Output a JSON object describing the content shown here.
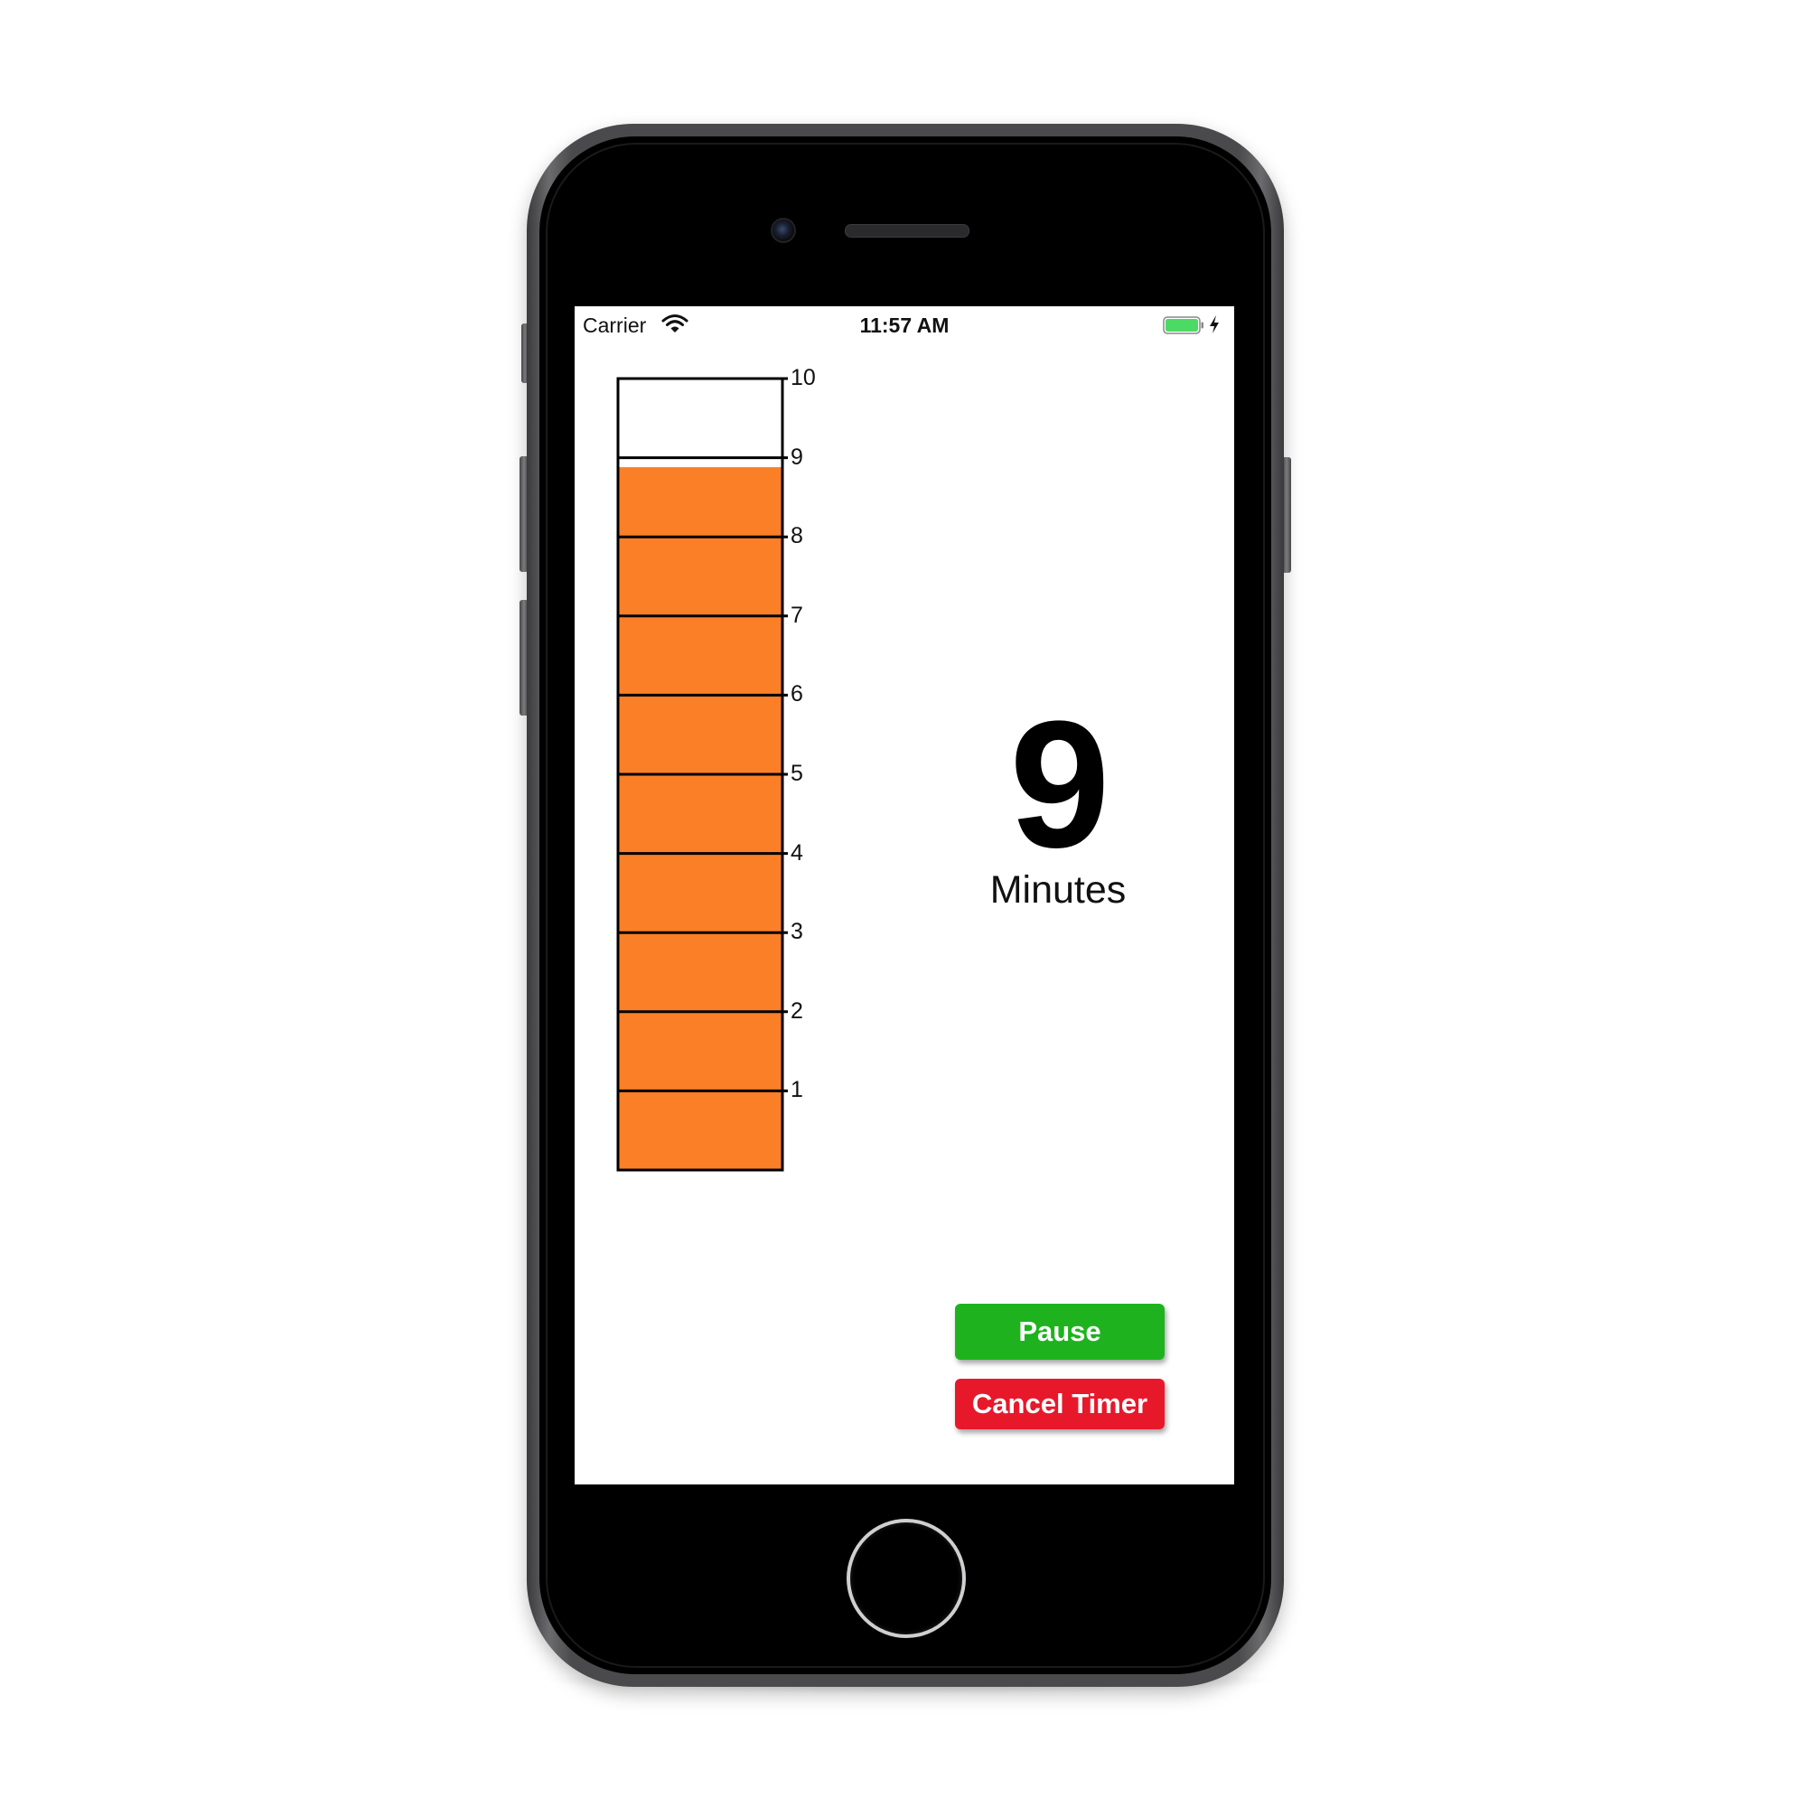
{
  "status_bar": {
    "carrier": "Carrier",
    "time": "11:57 AM",
    "battery_color": "#4cd964"
  },
  "timer_graph": {
    "ticks": [
      "1",
      "2",
      "3",
      "4",
      "5",
      "6",
      "7",
      "8",
      "9",
      "10"
    ],
    "max_minutes": 10,
    "remaining_minutes": 8.88,
    "fill_color": "#fa7f26",
    "outline_color": "#000000"
  },
  "remaining": {
    "value": "9",
    "unit": "Minutes"
  },
  "buttons": {
    "pause": {
      "label": "Pause",
      "color": "#1eb31e"
    },
    "cancel": {
      "label": "Cancel Timer",
      "color": "#e8182b"
    }
  }
}
